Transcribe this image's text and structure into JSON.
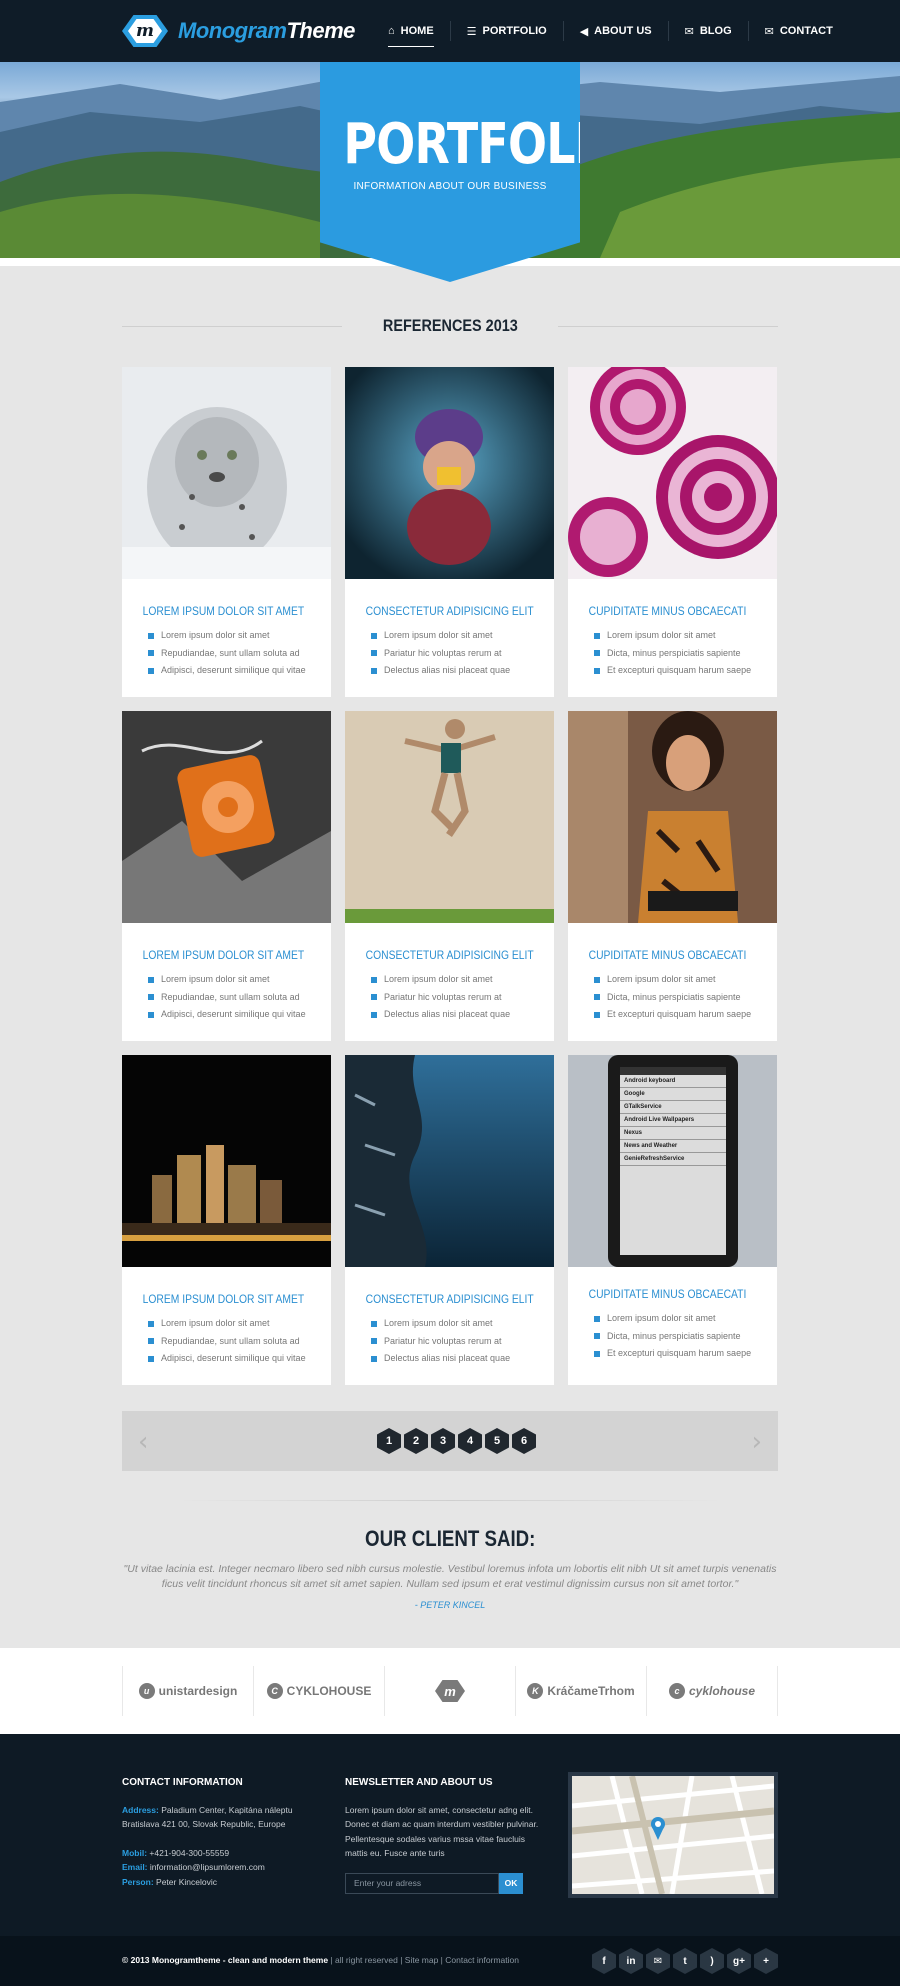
{
  "brand": {
    "name_a": "Monogram",
    "name_b": "Theme",
    "mark": "m"
  },
  "nav": [
    {
      "label": "HOME",
      "icon": "home-icon",
      "glyph": "⌂"
    },
    {
      "label": "PORTFOLIO",
      "icon": "list-icon",
      "glyph": "☰"
    },
    {
      "label": "ABOUT US",
      "icon": "megaphone-icon",
      "glyph": "◀"
    },
    {
      "label": "BLOG",
      "icon": "chat-bubbles-icon",
      "glyph": "✉"
    },
    {
      "label": "CONTACT",
      "icon": "envelope-icon",
      "glyph": "✉"
    }
  ],
  "hero": {
    "title": "PORTFOLIO",
    "subtitle": "INFORMATION ABOUT OUR BUSINESS"
  },
  "section_title": "REFERENCES 2013",
  "cards": [
    {
      "title": "LOREM IPSUM DOLOR SIT AMET",
      "items": [
        "Lorem ipsum dolor sit amet",
        "Repudiandae, sunt ullam soluta ad",
        "Adipisci, deserunt similique qui vitae"
      ],
      "image": "snow-leopard"
    },
    {
      "title": "CONSECTETUR ADIPISICING ELIT",
      "items": [
        "Lorem ipsum dolor sit amet",
        "Pariatur hic voluptas rerum at",
        "Delectus alias nisi placeat quae"
      ],
      "image": "swimmer-underwater"
    },
    {
      "title": "CUPIDITATE MINUS OBCAECATI",
      "items": [
        "Lorem ipsum dolor sit amet",
        "Dicta, minus perspiciatis sapiente",
        "Et excepturi quisquam harum saepe"
      ],
      "image": "red-onion-slices"
    },
    {
      "title": "LOREM IPSUM DOLOR SIT AMET",
      "items": [
        "Lorem ipsum dolor sit amet",
        "Repudiandae, sunt ullam soluta ad",
        "Adipisci, deserunt similique qui vitae"
      ],
      "image": "orange-music-player"
    },
    {
      "title": "CONSECTETUR ADIPISICING ELIT",
      "items": [
        "Lorem ipsum dolor sit amet",
        "Pariatur hic voluptas rerum at",
        "Delectus alias nisi placeat quae"
      ],
      "image": "diver-jumping"
    },
    {
      "title": "CUPIDITATE MINUS OBCAECATI",
      "items": [
        "Lorem ipsum dolor sit amet",
        "Dicta, minus perspiciatis sapiente",
        "Et excepturi quisquam harum saepe"
      ],
      "image": "woman-portrait"
    },
    {
      "title": "LOREM IPSUM DOLOR SIT AMET",
      "items": [
        "Lorem ipsum dolor sit amet",
        "Repudiandae, sunt ullam soluta ad",
        "Adipisci, deserunt similique qui vitae"
      ],
      "image": "city-night"
    },
    {
      "title": "CONSECTETUR ADIPISICING ELIT",
      "items": [
        "Lorem ipsum dolor sit amet",
        "Pariatur hic voluptas rerum at",
        "Delectus alias nisi placeat quae"
      ],
      "image": "rock-blue-sky"
    },
    {
      "title": "CUPIDITATE MINUS OBCAECATI",
      "items": [
        "Lorem ipsum dolor sit amet",
        "Dicta, minus perspiciatis sapiente",
        "Et excepturi quisquam harum saepe"
      ],
      "image": "android-phone"
    }
  ],
  "phone_rows": [
    "Android keyboard",
    "Google",
    "GTalkService",
    "Android Live Wallpapers",
    "Nexus",
    "News and Weather",
    "GenieRefreshService"
  ],
  "pagination": {
    "pages": [
      "1",
      "2",
      "3",
      "4",
      "5",
      "6"
    ],
    "prev": "‹",
    "next": "›"
  },
  "testimonial": {
    "heading": "OUR CLIENT SAID:",
    "quote": "\"Ut vitae lacinia est. Integer necmaro libero sed nibh cursus molestie. Vestibul loremus infota um lobortis elit nibh Ut sit amet turpis venenatis ficus velit tincidunt rhoncus sit amet sit amet sapien. Nullam sed ipsum et erat vestimul dignissim cursus non sit amet tortor.\"",
    "author": "- PETER KINCEL"
  },
  "clients": [
    {
      "mark": "u",
      "name": "unistardesign"
    },
    {
      "mark": "C",
      "name": "CYKLOHOUSE"
    },
    {
      "mark": "m",
      "name": ""
    },
    {
      "mark": "K",
      "name": "KráčameTrhom"
    },
    {
      "mark": "c",
      "name": "cyklohouse"
    }
  ],
  "footer": {
    "contact_title": "CONTACT INFORMATION",
    "address_label": "Address:",
    "address_1": "Paladium Center, Kapitána náleptu",
    "address_2": "Bratislava 421 00, Slovak Republic, Europe",
    "mobil_label": "Mobil:",
    "mobil": "+421-904-300-55559",
    "email_label": "Email:",
    "email": "information@lipsumlorem.com",
    "person_label": "Person:",
    "person": "Peter Kincelovic",
    "news_title": "NEWSLETTER AND ABOUT US",
    "news_text": "Lorem ipsum dolor sit amet, consectetur adng elit. Donec et diam ac quam interdum vestibler pulvinar. Pellentesque sodales varius mssa vitae faucluis mattis eu. Fusce ante turis",
    "news_placeholder": "Enter your adress",
    "news_button": "OK"
  },
  "bottom": {
    "copyright": "© 2013 Monogramtheme - clean and modern theme",
    "rights": " | all right reserved | Site map | Contact information"
  },
  "socials": [
    {
      "icon": "facebook-icon",
      "glyph": "f"
    },
    {
      "icon": "linkedin-icon",
      "glyph": "in"
    },
    {
      "icon": "mail-icon",
      "glyph": "✉"
    },
    {
      "icon": "twitter-icon",
      "glyph": "t"
    },
    {
      "icon": "rss-icon",
      "glyph": ")"
    },
    {
      "icon": "google-plus-icon",
      "glyph": "g+"
    },
    {
      "icon": "plus-icon",
      "glyph": "+"
    }
  ],
  "colors": {
    "accent": "#2b9be0",
    "header_bg": "#0f1c28",
    "footer_bg": "#0e1a25",
    "page_bg": "#e6e6e6"
  }
}
